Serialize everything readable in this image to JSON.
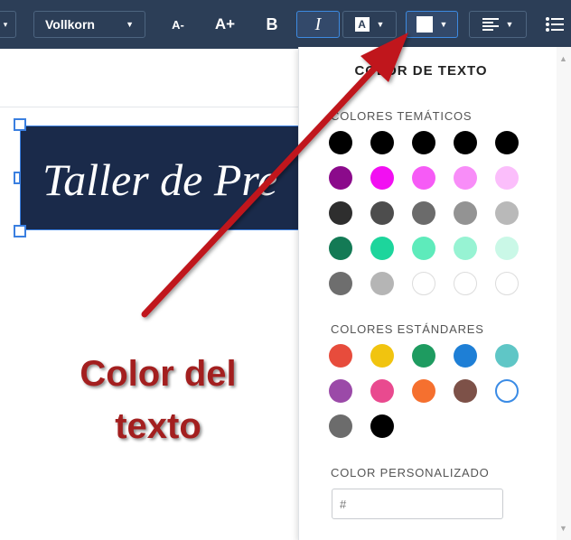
{
  "toolbar": {
    "font_name": "Vollkorn",
    "decrease_label": "A-",
    "increase_label": "A+",
    "bold_label": "B",
    "italic_label": "I",
    "highlight_label": "A"
  },
  "banner": {
    "text": "Taller de Pre"
  },
  "callout": {
    "line1": "Color del",
    "line2": "texto"
  },
  "panel": {
    "title": "COLOR DE TEXTO",
    "theme_label": "COLORES TEMÁTICOS",
    "standard_label": "COLORES ESTÁNDARES",
    "custom_label": "COLOR PERSONALIZADO",
    "custom_placeholder": "#"
  },
  "theme_colors": [
    [
      "#000000",
      "#000000",
      "#000000",
      "#000000",
      "#000000"
    ],
    [
      "#8b0a8b",
      "#f20ff2",
      "#f65bf6",
      "#f88df8",
      "#fbbefb"
    ],
    [
      "#2e2e2e",
      "#4d4d4d",
      "#6b6b6b",
      "#939393",
      "#b9b9b9"
    ],
    [
      "#137a55",
      "#1dd59c",
      "#5eebbb",
      "#97f3d3",
      "#caf8e7"
    ],
    [
      "#6e6e6e",
      "#b5b5b5",
      "#ffffff",
      "#ffffff",
      "#ffffff"
    ]
  ],
  "standard_colors": [
    [
      "#e74c3c",
      "#f1c40f",
      "#1e9b60",
      "#1e7fd6",
      "#5fc6c6"
    ],
    [
      "#9b4aa8",
      "#e94a8f",
      "#f5702f",
      "#7d5148",
      "#ffffff"
    ],
    [
      "#6c6c6c",
      "#000000"
    ]
  ],
  "colors": {
    "toolbar_bg": "#2c3e57",
    "accent": "#3a8be5",
    "banner_bg": "#1a2a4a",
    "callout": "#a31f1f",
    "arrow": "#c0141c"
  }
}
